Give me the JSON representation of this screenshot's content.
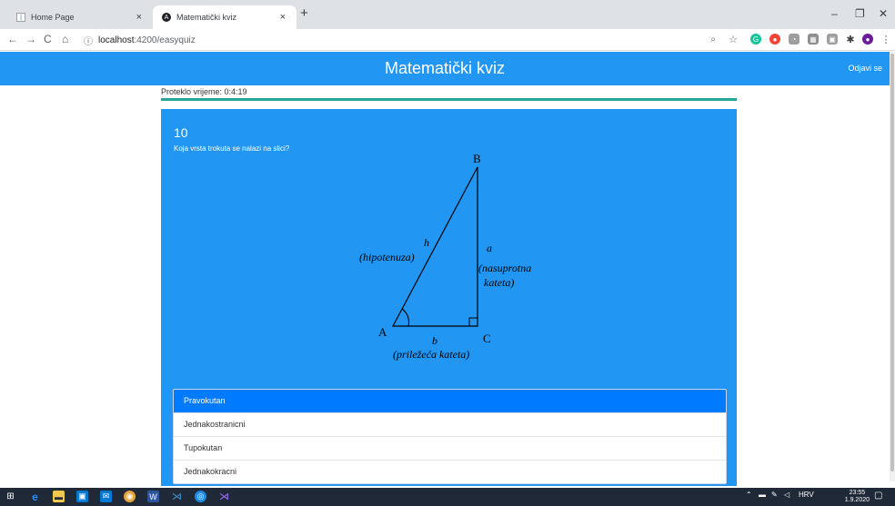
{
  "browser": {
    "tabs": [
      {
        "title": "Home Page",
        "close": "×"
      },
      {
        "title": "Matematički kviz",
        "close": "×"
      }
    ],
    "new_tab": "+",
    "window_controls": {
      "minimize": "–",
      "maximize": "❐",
      "close": "✕"
    },
    "nav": {
      "back": "←",
      "forward": "→",
      "reload": "C",
      "home": "⌂"
    },
    "url_host": "localhost",
    "url_rest": ":4200/easyquiz",
    "extensions": [
      "zoom-icon",
      "star-icon",
      "grammarly-icon",
      "adblock-icon",
      "extension-icon",
      "puzzle-icon",
      "cast-icon",
      "pin-icon",
      "profile-icon",
      "menu-icon"
    ]
  },
  "app": {
    "title": "Matematički kviz",
    "logout_label": "Odjavi se",
    "accent_color": "#2196f3",
    "active_answer_color": "#007bff"
  },
  "quiz": {
    "elapsed_time": "Proteklo vrijeme: 0:4:19",
    "progress": 1.0,
    "question_number": "10",
    "question_text": "Koja vrsta trokuta se nalazi na slici?",
    "figure": {
      "vertex_a": "A",
      "vertex_b": "B",
      "vertex_c": "C",
      "hyp_letter": "h",
      "hyp_label": "(hipotenuza)",
      "opp_letter": "a",
      "opp_label_1": "(nasuprotna",
      "opp_label_2": "kateta)",
      "adj_letter": "b",
      "adj_label": "(priležeća kateta)"
    },
    "answers": [
      {
        "label": "Pravokutan",
        "selected": true
      },
      {
        "label": "Jednakostranicni",
        "selected": false
      },
      {
        "label": "Tupokutan",
        "selected": false
      },
      {
        "label": "Jednakokracni",
        "selected": false
      }
    ]
  },
  "taskbar": {
    "apps": [
      "windows-start-icon",
      "edge-icon",
      "file-explorer-icon",
      "store-icon",
      "mail-icon",
      "chrome-icon",
      "word-icon",
      "vscode-icon",
      "app-icon",
      "visual-studio-icon"
    ],
    "language": "HRV",
    "time": "23:55",
    "date": "1.9.2020"
  }
}
